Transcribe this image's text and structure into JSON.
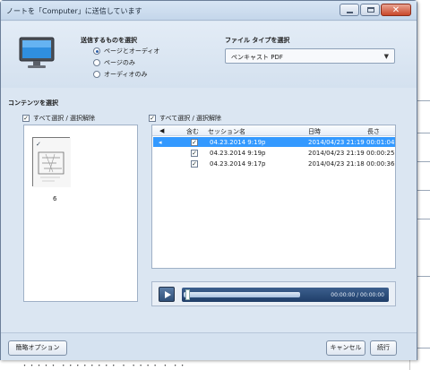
{
  "window": {
    "title": "ノートを「Computer」に送信しています",
    "controls": {
      "minimize_icon": "minimize-icon",
      "maximize_icon": "maximize-icon",
      "close_icon": "close-icon"
    }
  },
  "send": {
    "heading": "送信するものを選択",
    "options": [
      {
        "label": "ページとオーディオ",
        "selected": true
      },
      {
        "label": "ページのみ",
        "selected": false
      },
      {
        "label": "オーディオのみ",
        "selected": false
      }
    ]
  },
  "filetype": {
    "heading": "ファイル タイプを選択",
    "selected": "ペンキャスト PDF"
  },
  "content": {
    "heading": "コンテンツを選択",
    "pages_select_all": "すべて選択 / 選択解除",
    "sessions_select_all": "すべて選択 / 選択解除",
    "page_number": "6"
  },
  "sessions": {
    "columns": {
      "include": "含む",
      "name": "セッション名",
      "date": "日時",
      "length": "長さ"
    },
    "rows": [
      {
        "name": "04.23.2014 9:19p",
        "date": "2014/04/23 21:19",
        "length": "00:01:04",
        "selected": true
      },
      {
        "name": "04.23.2014 9:19p",
        "date": "2014/04/23 21:19",
        "length": "00:00:25",
        "selected": false
      },
      {
        "name": "04.23.2014 9:17p",
        "date": "2014/04/23 21:18",
        "length": "00:00:36",
        "selected": false
      }
    ]
  },
  "player": {
    "time": "00:00:00 / 00:00:00"
  },
  "footer": {
    "simple_options": "簡略オプション",
    "cancel": "キャンセル",
    "continue": "続行"
  },
  "background": {
    "bottom_text": "・・・・・ ・・・・・・・・ ・ ・・・・ ・ ・・"
  }
}
